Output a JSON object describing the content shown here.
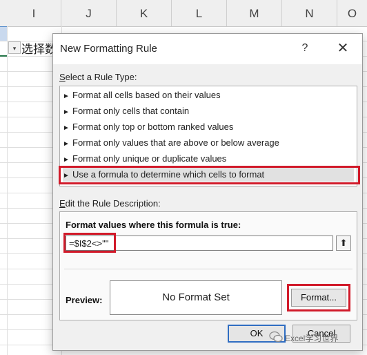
{
  "sheet": {
    "columns": [
      "I",
      "J",
      "K",
      "L",
      "M",
      "N",
      "O"
    ],
    "cell_text": "选择数",
    "dropdown_glyph": "▾"
  },
  "dialog": {
    "title": "New Formatting Rule",
    "help_glyph": "?",
    "close_glyph": "✕",
    "select_rule_label": "Select a Rule Type:",
    "select_rule_hotkey": "S",
    "select_rule_rest": "elect a Rule Type:",
    "rule_types": [
      {
        "label": "Format all cells based on their values"
      },
      {
        "label": "Format only cells that contain"
      },
      {
        "label": "Format only top or bottom ranked values"
      },
      {
        "label": "Format only values that are above or below average"
      },
      {
        "label": "Format only unique or duplicate values"
      },
      {
        "label": "Use a formula to determine which cells to format",
        "selected": true
      }
    ],
    "rule_arrow": "►",
    "edit_label_hotkey": "E",
    "edit_label_rest": "dit the Rule Description:",
    "formula_label_hotkey": "O",
    "formula_label": "Format values where this formula is true:",
    "formula_value": "=$I$2<>\"\"",
    "collapse_glyph": "⬆",
    "preview_label": "Preview:",
    "preview_text": "No Format Set",
    "format_button": "Format...",
    "ok_button": "OK",
    "cancel_button": "Cancel"
  },
  "watermark": {
    "text": "Excel学习世界"
  },
  "colors": {
    "highlight_red": "#d11a2a",
    "ok_border": "#2f6dc2",
    "excel_green": "#217346"
  }
}
